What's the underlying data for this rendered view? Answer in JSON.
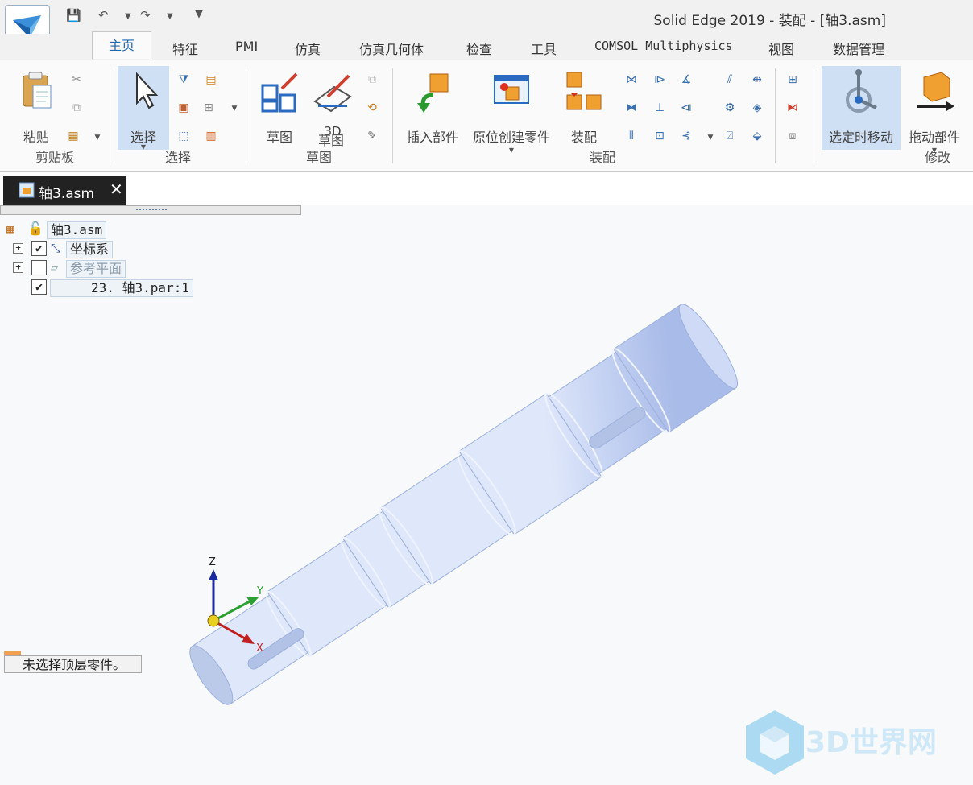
{
  "window": {
    "title": "Solid Edge 2019 - 装配 - [轴3.asm]"
  },
  "ribbon_tabs": [
    {
      "label": "主页",
      "active": true
    },
    {
      "label": "特征"
    },
    {
      "label": "PMI"
    },
    {
      "label": "仿真"
    },
    {
      "label": "仿真几何体"
    },
    {
      "label": "检查"
    },
    {
      "label": "工具"
    },
    {
      "label": "COMSOL Multiphysics"
    },
    {
      "label": "视图"
    },
    {
      "label": "数据管理"
    }
  ],
  "ribbon": {
    "clipboard": {
      "paste": "粘贴",
      "group": "剪贴板"
    },
    "select": {
      "select": "选择",
      "group": "选择"
    },
    "sketch": {
      "sketch": "草图",
      "sketch3d_line1": "3D",
      "sketch3d_line2": "草图",
      "group": "草图"
    },
    "assembly": {
      "insert": "插入部件",
      "create_in_place": "原位创建零件",
      "assemble": "装配",
      "group": "装配"
    },
    "modify": {
      "move_on_select": "选定时移动",
      "drag": "拖动部件",
      "group": "修改"
    }
  },
  "document_tab": {
    "label": "轴3.asm"
  },
  "tree": {
    "root": "轴3.asm",
    "items": [
      {
        "label": "坐标系",
        "checked": true
      },
      {
        "label": "参考平面",
        "checked": false
      },
      {
        "label": "23.  轴3.par:1",
        "checked": true
      }
    ]
  },
  "status": {
    "text": "未选择顶层零件。"
  },
  "triad": {
    "x": "X",
    "y": "Y",
    "z": "Z"
  },
  "watermark": {
    "text": "3D世界网"
  },
  "colors": {
    "shaft": "#c5d3f0",
    "active_tab": "#2266aa",
    "selected_button": "#cfe0f5"
  }
}
